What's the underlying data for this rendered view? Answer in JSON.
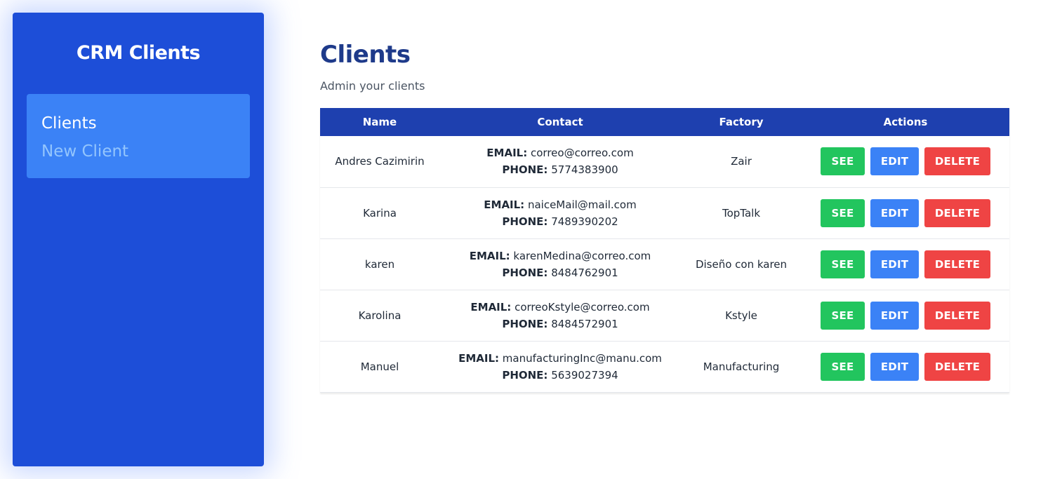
{
  "sidebar": {
    "title": "CRM Clients",
    "nav": [
      {
        "label": "Clients",
        "active": true
      },
      {
        "label": "New Client",
        "active": false
      }
    ]
  },
  "main": {
    "title": "Clients",
    "subtitle": "Admin your clients"
  },
  "table": {
    "headers": [
      "Name",
      "Contact",
      "Factory",
      "Actions"
    ],
    "email_label": "EMAIL:",
    "phone_label": "PHONE:",
    "actions": {
      "see": "SEE",
      "edit": "EDIT",
      "delete": "DELETE"
    },
    "rows": [
      {
        "name": "Andres Cazimirin",
        "email": "correo@correo.com",
        "phone": "5774383900",
        "factory": "Zair"
      },
      {
        "name": "Karina",
        "email": "naiceMail@mail.com",
        "phone": "7489390202",
        "factory": "TopTalk"
      },
      {
        "name": "karen",
        "email": "karenMedina@correo.com",
        "phone": "8484762901",
        "factory": "Diseño con karen"
      },
      {
        "name": "Karolina",
        "email": "correoKstyle@correo.com",
        "phone": "8484572901",
        "factory": "Kstyle"
      },
      {
        "name": "Manuel",
        "email": "manufacturingInc@manu.com",
        "phone": "5639027394",
        "factory": "Manufacturing"
      }
    ]
  },
  "colors": {
    "sidebar": "#1d4ed8",
    "nav_box": "#3b82f6",
    "table_header": "#1e40af",
    "see": "#22c55e",
    "edit": "#3b82f6",
    "delete": "#ef4444"
  }
}
